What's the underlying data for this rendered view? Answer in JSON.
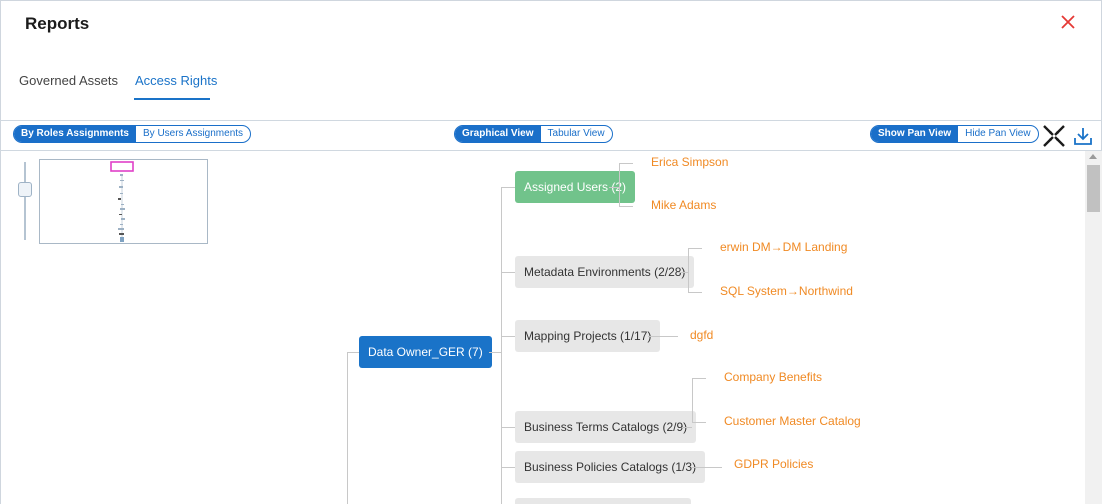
{
  "header": {
    "title": "Reports",
    "close_icon": "close-icon",
    "close_color": "#e53935"
  },
  "tabs": [
    {
      "label": "Governed Assets",
      "active": false
    },
    {
      "label": "Access Rights",
      "active": true
    }
  ],
  "toolbar": {
    "assignment_toggle": {
      "selected": "By Roles Assignments",
      "other": "By Users Assignments"
    },
    "view_toggle": {
      "selected": "Graphical View",
      "other": "Tabular View"
    },
    "pan_toggle": {
      "selected": "Show Pan View",
      "other": "Hide Pan View"
    },
    "icons": [
      "collapse-arrows-icon",
      "download-icon"
    ]
  },
  "tree": {
    "root": {
      "label": "Data Owner_GER (7)"
    },
    "branches": [
      {
        "label": "Assigned Users (2)",
        "style": "green",
        "leaves": [
          "Erica Simpson",
          "Mike Adams"
        ]
      },
      {
        "label": "Metadata Environments (2/28)",
        "style": "grey",
        "leaves": [
          "erwin DM→DM Landing",
          "SQL System→Northwind"
        ]
      },
      {
        "label": "Mapping Projects (1/17)",
        "style": "grey",
        "leaves": [
          "dgfd"
        ]
      },
      {
        "label": "Business Terms Catalogs (2/9)",
        "style": "grey",
        "leaves": [
          "Company Benefits",
          "Customer Master Catalog"
        ]
      },
      {
        "label": "Business Policies Catalogs (1/3)",
        "style": "grey",
        "leaves": [
          "GDPR Policies"
        ]
      }
    ]
  },
  "colors": {
    "accent": "#1a73c8",
    "assigned_users_node": "#71c38b",
    "category_node": "#e7e7e7",
    "leaf_text": "#f08a24",
    "connector": "#c8c8c8"
  }
}
